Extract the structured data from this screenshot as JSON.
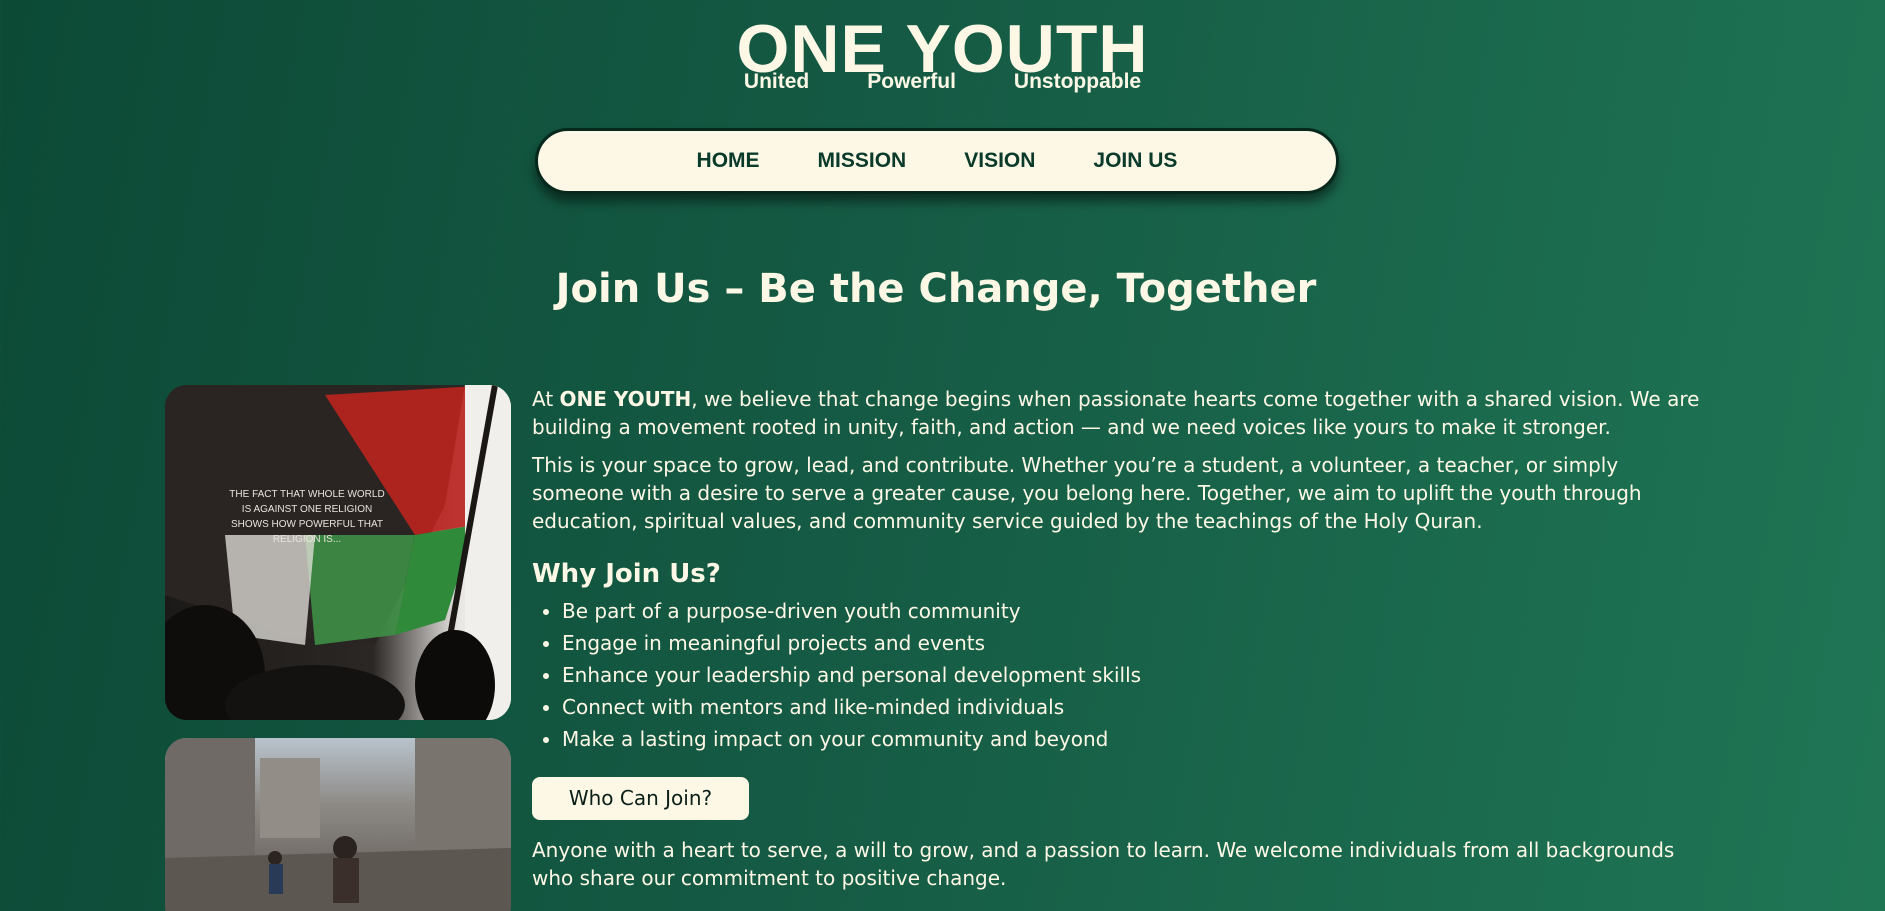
{
  "brand": {
    "title": "ONE YOUTH",
    "taglines": [
      "United",
      "Powerful",
      "Unstoppable"
    ]
  },
  "nav": {
    "items": [
      "HOME",
      "MISSION",
      "VISION",
      "JOIN US"
    ]
  },
  "page": {
    "title": "Join Us – Be the Change, Together"
  },
  "images": {
    "flag_caption": "THE FACT THAT WHOLE WORLD IS AGAINST ONE RELIGION SHOWS HOW POWERFUL THAT RELIGION IS..."
  },
  "intro": {
    "p1_prefix": "At ",
    "p1_brand": "ONE YOUTH",
    "p1_rest": ", we believe that change begins when passionate hearts come together with a shared vision. We are building a movement rooted in unity, faith, and action — and we need voices like yours to make it stronger.",
    "p2": "This is your space to grow, lead, and contribute. Whether you’re a student, a volunteer, a teacher, or simply someone with a desire to serve a greater cause, you belong here. Together, we aim to uplift the youth through education, spiritual values, and community service guided by the teachings of the Holy Quran."
  },
  "why": {
    "heading": "Why Join Us?",
    "items": [
      "Be part of a purpose-driven youth community",
      "Engage in meaningful projects and events",
      "Enhance your leadership and personal development skills",
      "Connect with mentors and like-minded individuals",
      "Make a lasting impact on your community and beyond"
    ]
  },
  "who": {
    "button_label": "Who Can Join?",
    "text": "Anyone with a heart to serve, a will to grow, and a passion to learn. We welcome individuals from all backgrounds who share our commitment to positive change."
  }
}
